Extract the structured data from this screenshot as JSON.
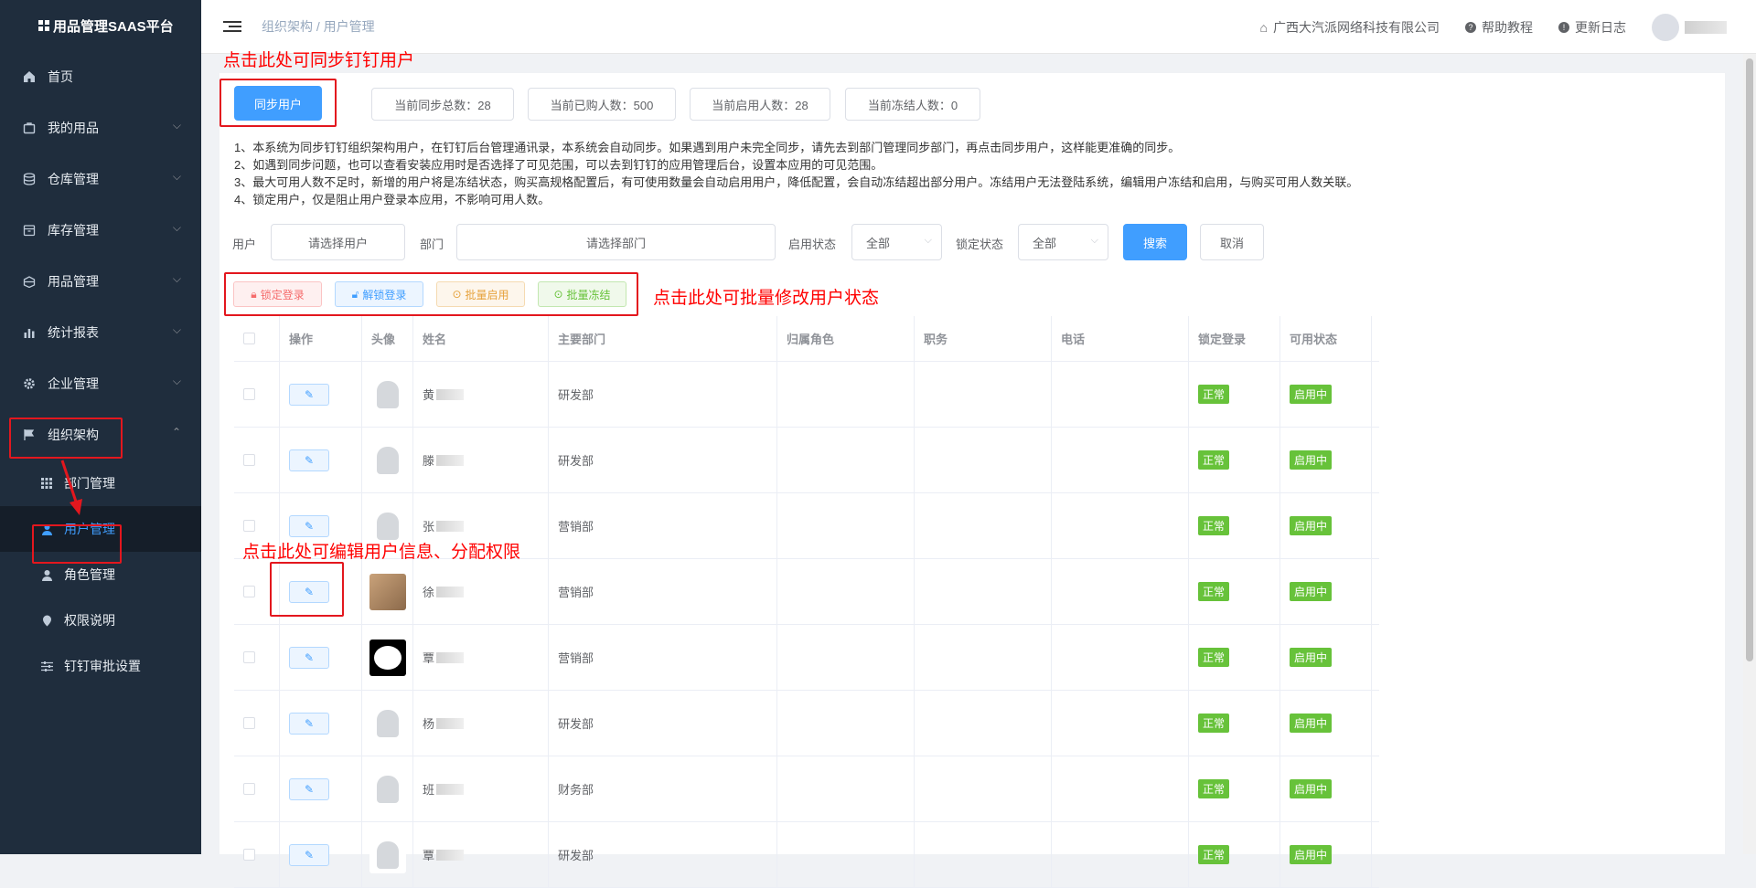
{
  "app": {
    "title": "用品管理SAAS平台"
  },
  "sidebar": {
    "items": [
      {
        "label": "首页",
        "icon": "home-icon"
      },
      {
        "label": "我的用品",
        "icon": "bag-icon"
      },
      {
        "label": "仓库管理",
        "icon": "database-icon"
      },
      {
        "label": "库存管理",
        "icon": "box-icon"
      },
      {
        "label": "用品管理",
        "icon": "box-icon"
      },
      {
        "label": "统计报表",
        "icon": "chart-icon"
      },
      {
        "label": "企业管理",
        "icon": "gear-icon"
      },
      {
        "label": "组织架构",
        "icon": "flag-icon"
      }
    ],
    "subitems": [
      {
        "label": "部门管理",
        "icon": "grid-icon"
      },
      {
        "label": "用户管理",
        "icon": "user-icon"
      },
      {
        "label": "角色管理",
        "icon": "user-icon"
      },
      {
        "label": "权限说明",
        "icon": "pin-icon"
      },
      {
        "label": "钉钉审批设置",
        "icon": "sliders-icon"
      }
    ]
  },
  "header": {
    "breadcrumb": "组织架构 / 用户管理",
    "company": "广西大汽派网络科技有限公司",
    "help": "帮助教程",
    "changelog": "更新日志"
  },
  "toolbar": {
    "sync_label": "同步用户",
    "stats": [
      "当前同步总数：28",
      "当前已购人数：500",
      "当前启用人数：28",
      "当前冻结人数：0"
    ]
  },
  "notes": [
    "1、本系统为同步钉钉组织架构用户，在钉钉后台管理通讯录，本系统会自动同步。如果遇到用户未完全同步，请先去到部门管理同步部门，再点击同步用户，这样能更准确的同步。",
    "2、如遇到同步问题，也可以查看安装应用时是否选择了可见范围，可以去到钉钉的应用管理后台，设置本应用的可见范围。",
    "3、最大可用人数不足时，新增的用户将是冻结状态，购买高规格配置后，有可使用数量会自动启用用户，降低配置，会自动冻结超出部分用户。冻结用户无法登陆系统，编辑用户冻结和启用，与购买可用人数关联。",
    "4、锁定用户，仅是阻止用户登录本应用，不影响可用人数。"
  ],
  "filters": {
    "user_label": "用户",
    "user_placeholder": "请选择用户",
    "dept_label": "部门",
    "dept_placeholder": "请选择部门",
    "enable_label": "启用状态",
    "enable_value": "全部",
    "lock_label": "锁定状态",
    "lock_value": "全部",
    "search": "搜索",
    "cancel": "取消"
  },
  "batch": {
    "lock": "锁定登录",
    "unlock": "解锁登录",
    "enable": "批量启用",
    "freeze": "批量冻结"
  },
  "table": {
    "headers": [
      "操作",
      "头像",
      "姓名",
      "主要部门",
      "归属角色",
      "职务",
      "电话",
      "锁定登录",
      "可用状态"
    ],
    "rows": [
      {
        "name": "黄",
        "dept": "研发部",
        "lock": "正常",
        "status": "启用中"
      },
      {
        "name": "滕",
        "dept": "研发部",
        "lock": "正常",
        "status": "启用中"
      },
      {
        "name": "张",
        "dept": "营销部",
        "lock": "正常",
        "status": "启用中"
      },
      {
        "name": "徐",
        "dept": "营销部",
        "lock": "正常",
        "status": "启用中"
      },
      {
        "name": "覃",
        "dept": "营销部",
        "lock": "正常",
        "status": "启用中"
      },
      {
        "name": "杨",
        "dept": "研发部",
        "lock": "正常",
        "status": "启用中"
      },
      {
        "name": "班",
        "dept": "财务部",
        "lock": "正常",
        "status": "启用中"
      },
      {
        "name": "覃",
        "dept": "研发部",
        "lock": "正常",
        "status": "启用中"
      }
    ]
  },
  "annotations": {
    "sync": "点击此处可同步钉钉用户",
    "batch": "点击此处可批量修改用户状态",
    "edit": "点击此处可编辑用户信息、分配权限"
  }
}
